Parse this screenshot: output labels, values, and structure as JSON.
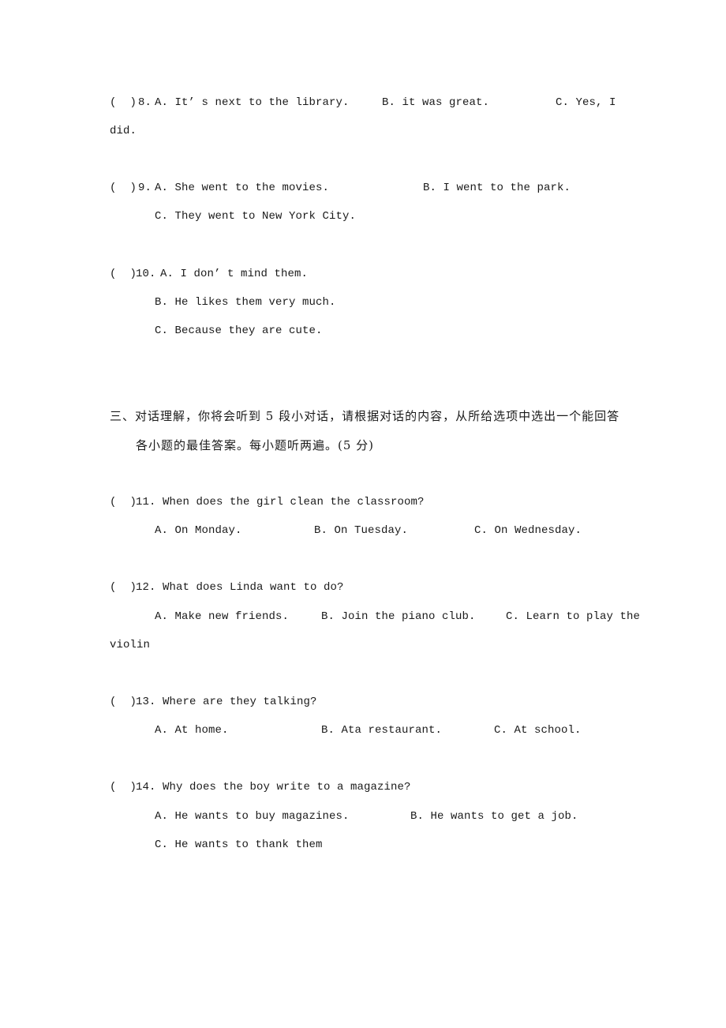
{
  "questions": {
    "q8": {
      "blank": "(  )",
      "number": "8.",
      "options": {
        "a": "A. It’ s next to the library.",
        "b": "B. it was great.",
        "c": "C. Yes, I",
        "c_cont": "did."
      }
    },
    "q9": {
      "blank": "(  )",
      "number": "9.",
      "options": {
        "a": "A. She went to the movies.",
        "b": "B. I went to the park.",
        "c": "C. They went to New York City."
      }
    },
    "q10": {
      "blank": "(  )",
      "number": "10.",
      "options": {
        "a": "A. I don’ t mind them.",
        "b": "B. He likes them very much.",
        "c": "C. Because they are cute."
      }
    }
  },
  "section3": {
    "heading_line1": "三、对话理解，你将会听到 5 段小对话，请根据对话的内容，从所给选项中选出一个能回答",
    "heading_line2": "各小题的最佳答案。每小题听两遍。(5 分)",
    "questions": {
      "q11": {
        "blank": "(  )",
        "stem": "11. When does the girl clean the classroom?",
        "options": {
          "a": "A. On Monday.",
          "b": "B. On Tuesday.",
          "c": "C. On Wednesday."
        }
      },
      "q12": {
        "blank": "(  )",
        "stem": "12. What does Linda want to do?",
        "options": {
          "a": "A. Make new friends.",
          "b": "B. Join the piano club.",
          "c": "C. Learn to play the",
          "c_cont": "violin"
        }
      },
      "q13": {
        "blank": "(  )",
        "stem": "13. Where are they talking?",
        "options": {
          "a": "A. At home.",
          "b": "B. Ata restaurant.",
          "c": "C. At school."
        }
      },
      "q14": {
        "blank": "(  )",
        "stem": "14. Why does the boy write to a magazine?",
        "options": {
          "a": "A. He wants to buy magazines.",
          "b": "B. He wants to get a job.",
          "c": "C. He wants to thank them"
        }
      }
    }
  }
}
